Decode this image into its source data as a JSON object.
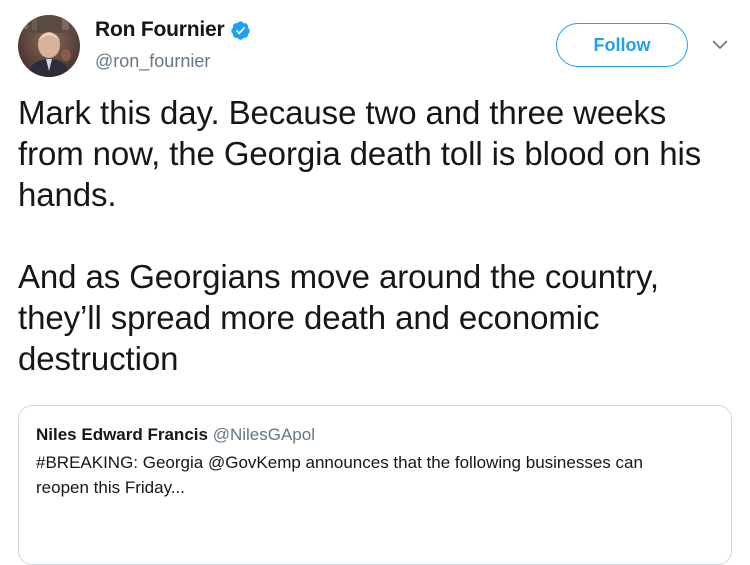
{
  "author": {
    "display_name": "Ron Fournier",
    "handle": "@ron_fournier",
    "verified_icon": "verified-badge-icon",
    "avatar_icon": "profile-photo"
  },
  "actions": {
    "follow_label": "Follow",
    "menu_icon": "chevron-down-icon"
  },
  "tweet": {
    "paragraphs": [
      "Mark this day. Because two and three weeks from now, the Georgia death toll is blood on his hands.",
      "And as Georgians move around the country, they’ll spread more death and economic destruction"
    ]
  },
  "quoted_tweet": {
    "display_name": "Niles Edward Francis",
    "handle": "@NilesGApol",
    "text": "#BREAKING: Georgia @GovKemp announces that the following businesses can reopen this Friday..."
  },
  "colors": {
    "accent": "#1da1f2",
    "text": "#14171a",
    "secondary": "#657786",
    "border": "#ccd6dd"
  }
}
